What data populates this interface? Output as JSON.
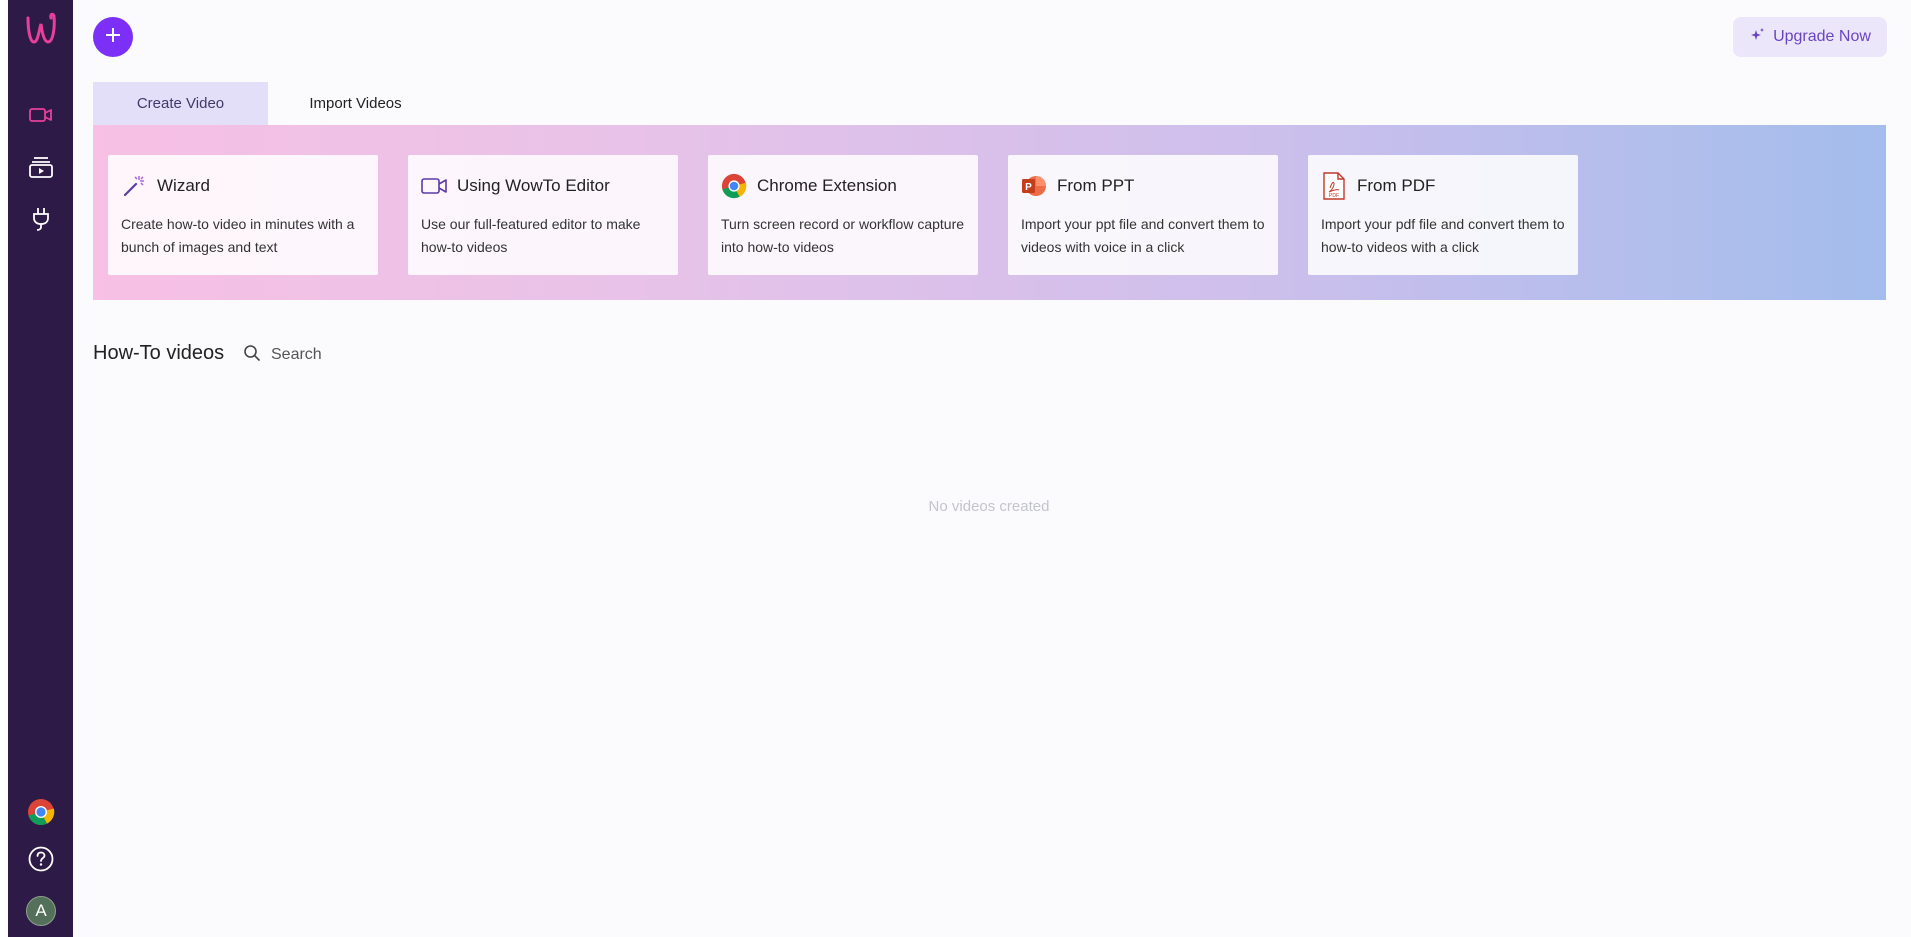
{
  "sidebar": {
    "logo_text": "w",
    "items": [
      {
        "icon": "video-camera-icon",
        "active": true
      },
      {
        "icon": "video-library-icon",
        "active": false
      },
      {
        "icon": "plug-icon",
        "active": false
      }
    ],
    "bottom": [
      {
        "icon": "chrome-icon"
      },
      {
        "icon": "help-icon"
      }
    ],
    "avatar_initial": "A"
  },
  "header": {
    "add_icon": "plus-icon",
    "upgrade_label": "Upgrade Now",
    "upgrade_icon": "sparkle-icon"
  },
  "tabs": [
    {
      "label": "Create Video",
      "active": true
    },
    {
      "label": "Import Videos",
      "active": false
    }
  ],
  "cards": [
    {
      "title": "Wizard",
      "description": "Create how-to video in minutes with a bunch of images and text",
      "icon": "magic-wand-icon"
    },
    {
      "title": "Using WowTo Editor",
      "description": "Use our full-featured editor to make how-to videos",
      "icon": "video-camera-icon"
    },
    {
      "title": "Chrome Extension",
      "description": "Turn screen record or workflow capture into how-to videos",
      "icon": "chrome-icon"
    },
    {
      "title": "From PPT",
      "description": "Import your ppt file and convert them to videos with voice in a click",
      "icon": "powerpoint-icon"
    },
    {
      "title": "From PDF",
      "description": "Import your pdf file and convert them to how-to videos with a click",
      "icon": "pdf-icon"
    }
  ],
  "videos_section": {
    "title": "How-To videos",
    "search_placeholder": "Search",
    "empty_message": "No videos created"
  },
  "colors": {
    "sidebar_bg": "#2e1a47",
    "accent": "#7b2ff7",
    "logo": "#e8409a",
    "active_icon": "#e8409a"
  }
}
